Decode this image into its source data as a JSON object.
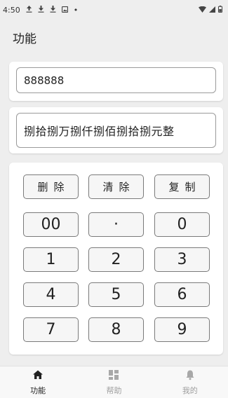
{
  "status": {
    "time": "4:50",
    "left_icons": [
      "upload-icon",
      "download-icon",
      "download-icon",
      "image-icon"
    ],
    "dot": "•",
    "right_icons": [
      "wifi-icon",
      "signal-icon",
      "battery-icon"
    ]
  },
  "app_bar": {
    "title": "功能"
  },
  "input": {
    "value": "888888"
  },
  "output": {
    "value": "捌拾捌万捌仟捌佰捌拾捌元整"
  },
  "keypad": {
    "delete": "删除",
    "clear": "清除",
    "copy": "复制",
    "keys": [
      "00",
      "·",
      "0",
      "1",
      "2",
      "3",
      "4",
      "5",
      "6",
      "7",
      "8",
      "9"
    ]
  },
  "nav": {
    "items": [
      {
        "label": "功能",
        "icon": "home-icon",
        "active": true
      },
      {
        "label": "帮助",
        "icon": "dashboard-icon",
        "active": false
      },
      {
        "label": "我的",
        "icon": "bell-icon",
        "active": false
      }
    ]
  },
  "colors": {
    "background": "#eeeeee",
    "card": "#ffffff",
    "active": "#222222",
    "inactive": "#9e9e9e"
  }
}
